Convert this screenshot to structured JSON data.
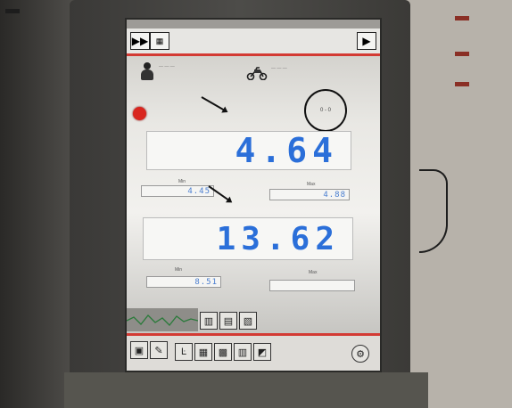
{
  "window": {
    "menu_label": "",
    "title": "",
    "close_label": ""
  },
  "circle_badge": {
    "text": "0 - 0"
  },
  "primary_reading": {
    "label": "",
    "value": "4.64"
  },
  "primary_min": {
    "label": "Min",
    "value": "4.45"
  },
  "primary_max": {
    "label": "Max",
    "value": "4.88"
  },
  "secondary_reading": {
    "label": "",
    "value": "13.62"
  },
  "secondary_min": {
    "label": "Min",
    "value": "8.51"
  },
  "secondary_max": {
    "label": "Max",
    "value": ""
  },
  "icons": {
    "toolbar": [
      "fast-forward-icon",
      "photo-icon",
      "play-icon"
    ],
    "header": [
      "rider-icon",
      "motorcycle-icon"
    ],
    "bottom": [
      "waveform-icon",
      "tool-icon-1",
      "tool-icon-2",
      "tool-icon-3"
    ],
    "taskbar": [
      "window-icon",
      "pen-icon",
      "text-icon",
      "grid-icon",
      "tools-icon",
      "chart-icon",
      "gauge-icon",
      "wrench-icon"
    ]
  },
  "colors": {
    "accent_red": "#d33a33",
    "digit_blue": "#2b6fd9",
    "record_red": "#d9261f"
  }
}
